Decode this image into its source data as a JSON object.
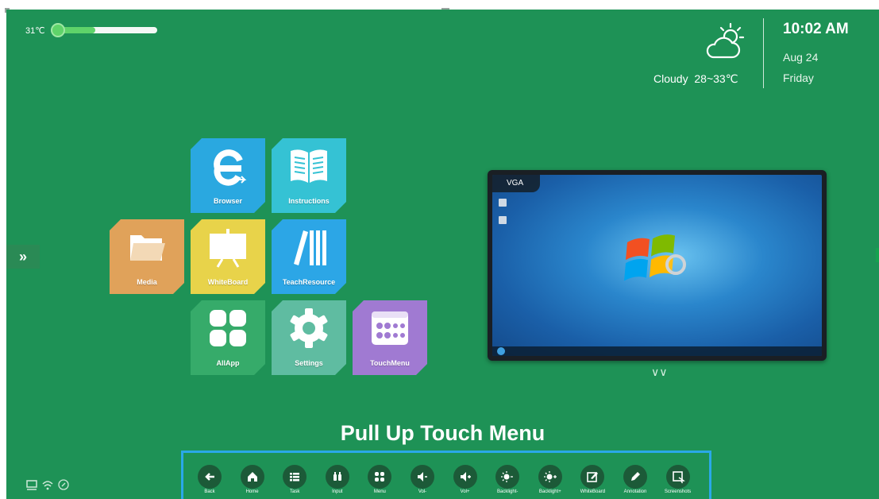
{
  "temperature": {
    "label": "31℃",
    "level_fraction": 0.42
  },
  "weather": {
    "condition": "Cloudy",
    "range": "28~33℃",
    "icon": "cloud-sun-icon"
  },
  "clock": {
    "time": "10:02 AM",
    "date": "Aug 24",
    "weekday": "Friday"
  },
  "side_expand": {
    "glyph": "»"
  },
  "apps": {
    "browser": {
      "label": "Browser",
      "color": "#2aa8e0"
    },
    "instructions": {
      "label": "Instructions",
      "color": "#35c2d4"
    },
    "media": {
      "label": "Media",
      "color": "#e0a25a"
    },
    "whiteboard": {
      "label": "WhiteBoard",
      "color": "#e8d34a"
    },
    "teachresource": {
      "label": "TeachResource",
      "color": "#2ca6e6"
    },
    "allapp": {
      "label": "AllApp",
      "color": "#36ab6a"
    },
    "settings": {
      "label": "Settings",
      "color": "#5fbca1"
    },
    "touchmenu": {
      "label": "TouchMenu",
      "color": "#a07ad2"
    }
  },
  "preview": {
    "source": "VGA"
  },
  "touch_menu": {
    "title": "Pull Up Touch Menu",
    "items": [
      {
        "label": "Back",
        "icon": "back-arrow-icon"
      },
      {
        "label": "Home",
        "icon": "home-icon"
      },
      {
        "label": "Task",
        "icon": "task-list-icon"
      },
      {
        "label": "Input",
        "icon": "input-icon"
      },
      {
        "label": "Menu",
        "icon": "menu-grid-icon"
      },
      {
        "label": "Vol-",
        "icon": "volume-down-icon"
      },
      {
        "label": "Vol+",
        "icon": "volume-up-icon"
      },
      {
        "label": "Backlight-",
        "icon": "backlight-down-icon"
      },
      {
        "label": "Backlight+",
        "icon": "backlight-up-icon"
      },
      {
        "label": "WhiteBoard",
        "icon": "whiteboard-edit-icon"
      },
      {
        "label": "Annotation",
        "icon": "pen-icon"
      },
      {
        "label": "Screenshots",
        "icon": "screenshot-icon"
      }
    ]
  },
  "status_icons": [
    "screen-icon",
    "wifi-icon",
    "link-icon"
  ]
}
